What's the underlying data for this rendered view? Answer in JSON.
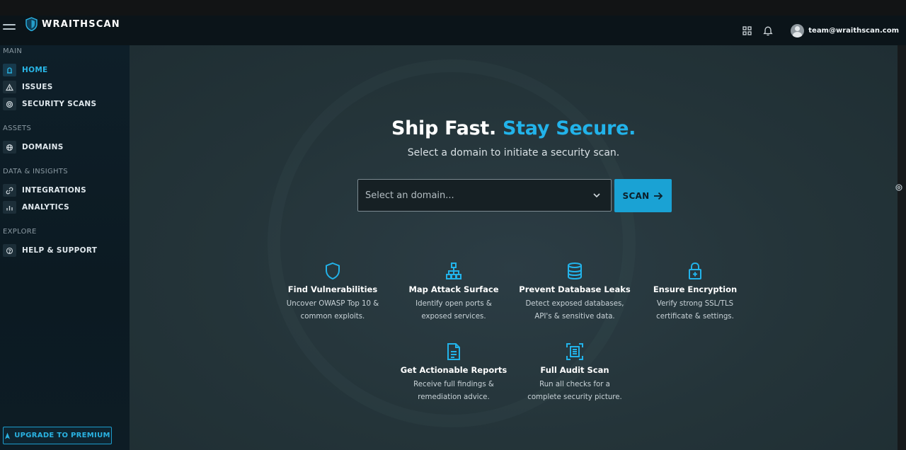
{
  "app": {
    "name": "WRAITHSCAN"
  },
  "header": {
    "user_email": "team@wraithscan.com"
  },
  "sidebar": {
    "sections": [
      {
        "label": "MAIN",
        "items": [
          {
            "label": "HOME",
            "icon": "home-icon",
            "active": true
          },
          {
            "label": "ISSUES",
            "icon": "warning-icon"
          },
          {
            "label": "SECURITY SCANS",
            "icon": "target-icon"
          }
        ]
      },
      {
        "label": "ASSETS",
        "items": [
          {
            "label": "DOMAINS",
            "icon": "globe-icon"
          }
        ]
      },
      {
        "label": "DATA & INSIGHTS",
        "items": [
          {
            "label": "INTEGRATIONS",
            "icon": "link-icon"
          },
          {
            "label": "ANALYTICS",
            "icon": "bar-chart-icon"
          }
        ]
      },
      {
        "label": "EXPLORE",
        "items": [
          {
            "label": "HELP & SUPPORT",
            "icon": "help-icon"
          }
        ]
      }
    ],
    "upgrade_label": "UPGRADE TO PREMIUM"
  },
  "hero": {
    "title_main": "Ship Fast. ",
    "title_accent": "Stay Secure.",
    "subtitle": "Select a domain to initiate a security scan.",
    "select_placeholder": "Select an domain...",
    "scan_label": "SCAN"
  },
  "features": [
    {
      "title": "Find Vulnerabilities",
      "desc": "Uncover OWASP Top 10 &\ncommon exploits.",
      "icon": "shield-icon"
    },
    {
      "title": "Map Attack Surface",
      "desc": "Identify open ports &\nexposed services.",
      "icon": "network-icon"
    },
    {
      "title": "Prevent Database Leaks",
      "desc": "Detect exposed databases,\nAPI's & sensitive data.",
      "icon": "database-icon"
    },
    {
      "title": "Ensure Encryption",
      "desc": "Verify strong SSL/TLS\ncertificate & settings.",
      "icon": "lock-icon"
    },
    {
      "title": "Get Actionable Reports",
      "desc": "Receive full findings &\nremediation advice.",
      "icon": "document-icon"
    },
    {
      "title": "Full Audit Scan",
      "desc": "Run all checks for a\ncomplete security picture.",
      "icon": "audit-icon"
    }
  ],
  "colors": {
    "accent": "#22b3ea",
    "sidebar_bg": "#0e1f29",
    "main_bg": "#243439"
  }
}
